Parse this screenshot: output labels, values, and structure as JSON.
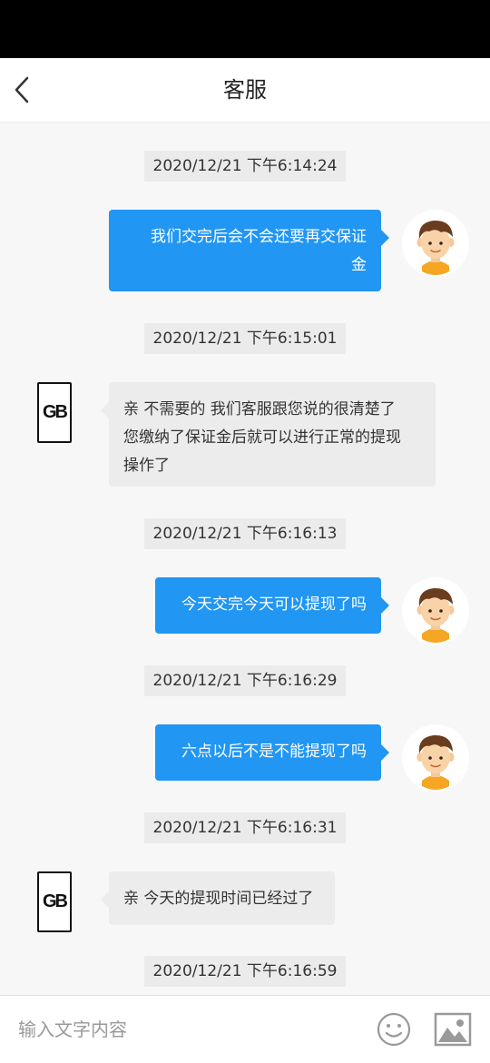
{
  "header": {
    "title": "客服"
  },
  "messages": [
    {
      "timestamp": "2020/12/21 下午6:14:24",
      "from": "user",
      "lines": [
        "我们交完后会不会还要再交保证",
        "金"
      ]
    },
    {
      "timestamp": "2020/12/21 下午6:15:01",
      "from": "service",
      "lines": [
        "亲 不需要的 我们客服跟您说的很清楚了",
        "您缴纳了保证金后就可以进行正常的提现",
        "操作了"
      ]
    },
    {
      "timestamp": "2020/12/21 下午6:16:13",
      "from": "user",
      "lines": [
        "今天交完今天可以提现了吗"
      ]
    },
    {
      "timestamp": "2020/12/21 下午6:16:29",
      "from": "user",
      "lines": [
        "六点以后不是不能提现了吗"
      ]
    },
    {
      "timestamp": "2020/12/21 下午6:16:31",
      "from": "service",
      "lines": [
        "亲 今天的提现时间已经过了"
      ]
    },
    {
      "timestamp": "2020/12/21 下午6:16:59"
    }
  ],
  "service_avatar_text": "GB",
  "input": {
    "placeholder": "输入文字内容"
  },
  "colors": {
    "user_bubble": "#2196f3",
    "service_bubble": "#ececec",
    "timestamp_bg": "#ebebeb",
    "avatar_orange": "#f5a623"
  }
}
